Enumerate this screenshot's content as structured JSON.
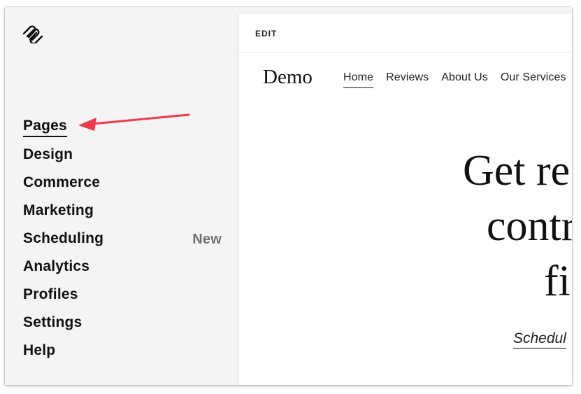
{
  "sidebar": {
    "logo": "squarespace-logo",
    "items": [
      {
        "label": "Pages",
        "active": true,
        "badge": ""
      },
      {
        "label": "Design",
        "active": false,
        "badge": ""
      },
      {
        "label": "Commerce",
        "active": false,
        "badge": ""
      },
      {
        "label": "Marketing",
        "active": false,
        "badge": ""
      },
      {
        "label": "Scheduling",
        "active": false,
        "badge": "New"
      },
      {
        "label": "Analytics",
        "active": false,
        "badge": ""
      },
      {
        "label": "Profiles",
        "active": false,
        "badge": ""
      },
      {
        "label": "Settings",
        "active": false,
        "badge": ""
      },
      {
        "label": "Help",
        "active": false,
        "badge": ""
      }
    ]
  },
  "annotation": {
    "type": "arrow",
    "color": "#f2384a",
    "points_to": "Pages"
  },
  "preview": {
    "edit_label": "EDIT",
    "site_title": "Demo",
    "nav": [
      {
        "label": "Home",
        "active": true
      },
      {
        "label": "Reviews",
        "active": false
      },
      {
        "label": "About Us",
        "active": false
      },
      {
        "label": "Our Services",
        "active": false
      }
    ],
    "hero_lines": [
      "Get re",
      "contr",
      "fi"
    ],
    "cta_label": "Schedul"
  }
}
